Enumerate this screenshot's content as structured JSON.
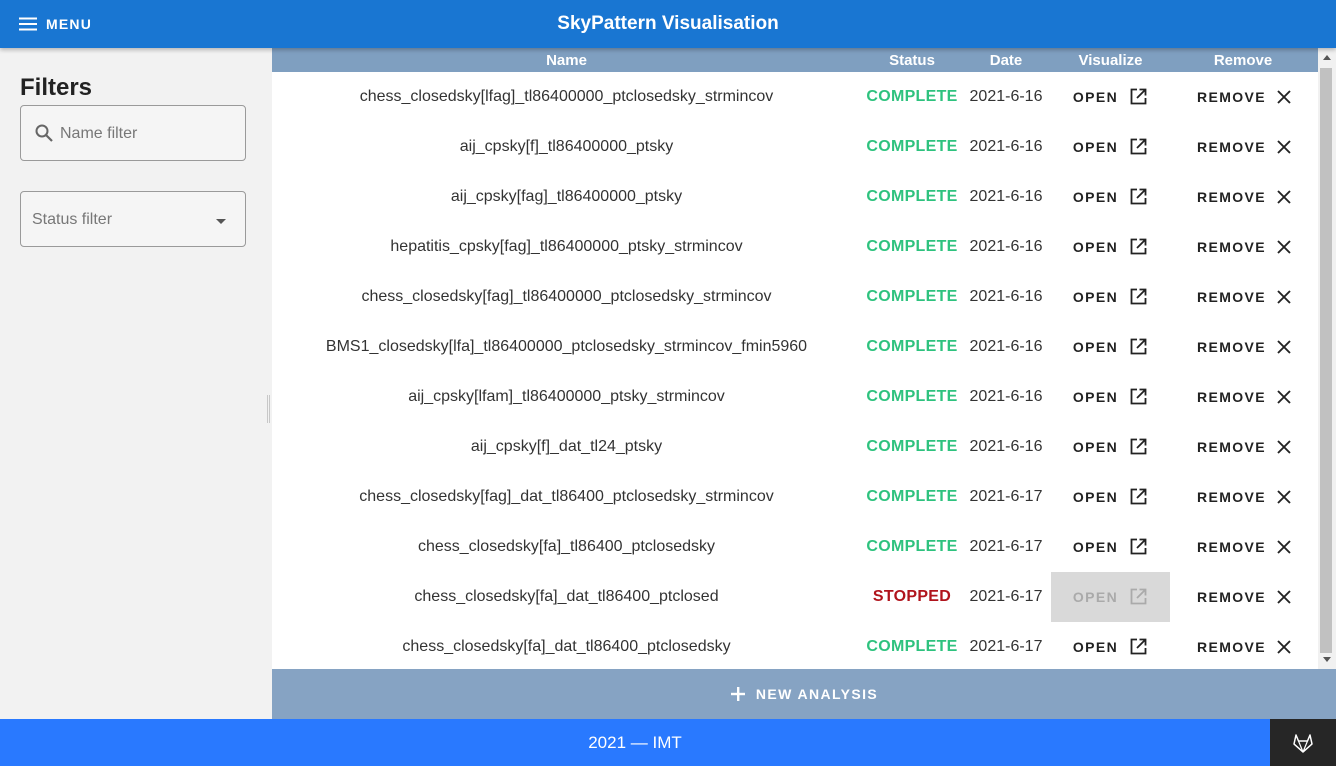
{
  "appbar": {
    "menu_label": "MENU",
    "title": "SkyPattern Visualisation"
  },
  "sidebar": {
    "title": "Filters",
    "name_placeholder": "Name filter",
    "status_placeholder": "Status filter"
  },
  "table": {
    "headers": {
      "name": "Name",
      "status": "Status",
      "date": "Date",
      "visualize": "Visualize",
      "remove": "Remove"
    },
    "open_label": "OPEN",
    "remove_label": "REMOVE",
    "rows": [
      {
        "name": "chess_closedsky[lfag]_tl86400000_ptclosedsky_strmincov",
        "status": "COMPLETE",
        "date": "2021-6-16"
      },
      {
        "name": "aij_cpsky[f]_tl86400000_ptsky",
        "status": "COMPLETE",
        "date": "2021-6-16"
      },
      {
        "name": "aij_cpsky[fag]_tl86400000_ptsky",
        "status": "COMPLETE",
        "date": "2021-6-16"
      },
      {
        "name": "hepatitis_cpsky[fag]_tl86400000_ptsky_strmincov",
        "status": "COMPLETE",
        "date": "2021-6-16"
      },
      {
        "name": "chess_closedsky[fag]_tl86400000_ptclosedsky_strmincov",
        "status": "COMPLETE",
        "date": "2021-6-16"
      },
      {
        "name": "BMS1_closedsky[lfa]_tl86400000_ptclosedsky_strmincov_fmin5960",
        "status": "COMPLETE",
        "date": "2021-6-16"
      },
      {
        "name": "aij_cpsky[lfam]_tl86400000_ptsky_strmincov",
        "status": "COMPLETE",
        "date": "2021-6-16"
      },
      {
        "name": "aij_cpsky[f]_dat_tl24_ptsky",
        "status": "COMPLETE",
        "date": "2021-6-16"
      },
      {
        "name": "chess_closedsky[fag]_dat_tl86400_ptclosedsky_strmincov",
        "status": "COMPLETE",
        "date": "2021-6-17"
      },
      {
        "name": "chess_closedsky[fa]_tl86400_ptclosedsky",
        "status": "COMPLETE",
        "date": "2021-6-17"
      },
      {
        "name": "chess_closedsky[fa]_dat_tl86400_ptclosed",
        "status": "STOPPED",
        "date": "2021-6-17"
      },
      {
        "name": "chess_closedsky[fa]_dat_tl86400_ptclosedsky",
        "status": "COMPLETE",
        "date": "2021-6-17"
      }
    ]
  },
  "new_analysis_label": "NEW ANALYSIS",
  "footer": {
    "text": "2021 — IMT"
  },
  "icons": {
    "menu": "menu-icon",
    "search": "search-icon",
    "dropdown": "caret-down-icon",
    "open": "open-in-new-icon",
    "remove": "close-icon",
    "add": "plus-icon",
    "gitlab": "gitlab-icon"
  },
  "colors": {
    "appbar": "#1976d2",
    "table_header": "#7f9fc0",
    "new_bar": "#86a3c3",
    "footer": "#2979ff",
    "complete": "#2ec27e",
    "stopped": "#b0141c",
    "gitlab_bg": "#262626"
  }
}
